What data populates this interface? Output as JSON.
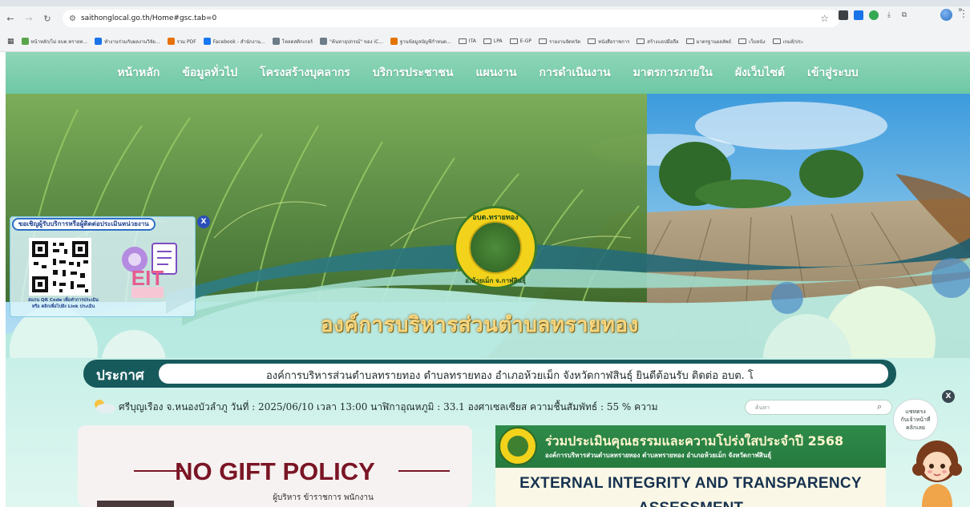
{
  "browser": {
    "url": "saithonglocal.go.th/Home#gsc.tab=0",
    "bookmarks": [
      {
        "label": "หน้าหลัก/ไม่ อบต.ทรายท...",
        "color": "#5aa44a"
      },
      {
        "label": "ทำงานร่วมกับผลงานวิจัย...",
        "color": "#1a73e8"
      },
      {
        "label": "รวม PDF",
        "color": "#e8710a"
      },
      {
        "label": "Facebook - สำนักงาน...",
        "color": "#1877f2"
      },
      {
        "label": "โหลดสติกเกอร์",
        "color": "#6d7c89"
      },
      {
        "label": "\"ค้นหาอุปกรณ์\" ของ iC...",
        "color": "#6d7c89"
      },
      {
        "label": "ฐานข้อมูลบัญชีกำหนด...",
        "color": "#e37400"
      },
      {
        "label": "ITA",
        "folder": true
      },
      {
        "label": "LPA",
        "folder": true
      },
      {
        "label": "E-GP",
        "folder": true
      },
      {
        "label": "รายงานจัดหวัด",
        "folder": true
      },
      {
        "label": "หนังสือราชการ",
        "folder": true
      },
      {
        "label": "สร้างแอปมือถือ",
        "folder": true
      },
      {
        "label": "มาตรฐานผลลัพธ์",
        "folder": true
      },
      {
        "label": "เว็บหนัง",
        "folder": true
      },
      {
        "label": "เกมส์/ประ",
        "folder": true
      }
    ],
    "more": "»"
  },
  "nav": {
    "items": [
      "หน้าหลัก",
      "ข้อมูลทั่วไป",
      "โครงสร้างบุคลากร",
      "บริการประชาชน",
      "แผนงาน",
      "การดำเนินงาน",
      "มาตรการภายใน",
      "ผังเว็บไซต์",
      "เข้าสู่ระบบ"
    ]
  },
  "hero": {
    "title": "องค์การบริหารส่วนตำบลทรายทอง",
    "seal_top": "อบต.ทรายทอง",
    "seal_bottom": "อ.ห้วยเม็ก จ.กาฬสินธุ์"
  },
  "eit_popup": {
    "heading": "ขอเชิญผู้รับบริการหรือผู้ติดต่อประเมินหน่วยงาน",
    "caption_line1": "สแกน QR Code เพื่อทำการประเมิน",
    "caption_line2": "หรือ คลิกเพื่อไปยัง Link ประเมิน",
    "logo_text": "EIT",
    "close": "X"
  },
  "announcement": {
    "label": "ประกาศ",
    "text": "องค์การบริหารส่วนตำบลทรายทอง ตำบลทรายทอง อำเภอห้วยเม็ก จังหวัดกาฬสินธุ์ ยินดีต้อนรับ        ติดต่อ อบต. โ"
  },
  "weather": {
    "text": "ศรีบุญเรือง จ.หนองบัวลำภู วันที่ : 2025/06/10 เวลา 13:00 นาฬิกาอุณหภูมิ : 33.1 องศาเซลเซียส ความชื้นสัมพัทธ์ : 55 % ความ"
  },
  "search": {
    "placeholder": "ค้นหา"
  },
  "chat": {
    "line1": "แชทตรง",
    "line2": "กับเจ้าหน้าที่",
    "line3": "คลิกเลย",
    "close": "X"
  },
  "no_gift": {
    "title": "NO GIFT POLICY",
    "subtitle": "ผู้บริหาร ข้าราชการ พนักงาน"
  },
  "ita_banner": {
    "title": "ร่วมประเมินคุณธรรมและความโปร่งใสประจำปี 2568",
    "subtitle": "องค์การบริหารส่วนตำบลทรายทอง ตำบลทรายทอง อำเภอห้วยเม็ก จังหวัดกาฬสินธุ์",
    "english_line1": "EXTERNAL INTEGRITY AND TRANSPARENCY",
    "english_line2": "ASSESSMENT"
  },
  "colors": {
    "nav_bg": "#7ccfae",
    "announce_bg": "#175a5c",
    "gift_accent": "#7a1525",
    "ita_green": "#2f8b4a"
  }
}
